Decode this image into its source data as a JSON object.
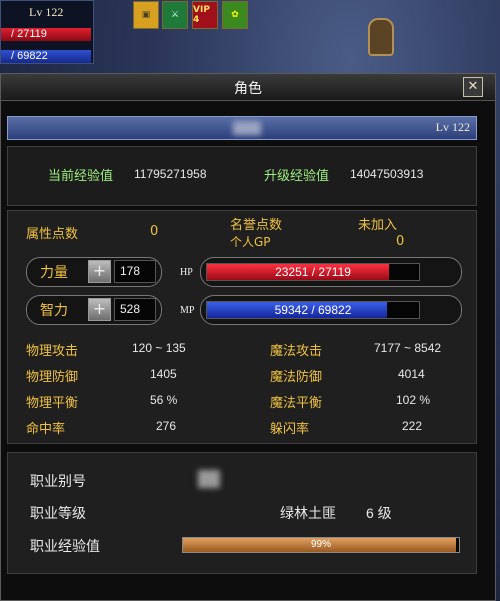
{
  "hud": {
    "level": "Lv 122",
    "hp_text": "/ 27119",
    "mp_text": "/ 69822",
    "hp_color": "#e02030",
    "mp_color": "#3050d0",
    "buffs": [
      {
        "icon": "treasure-chest-icon",
        "label": ""
      },
      {
        "icon": "sword-icon",
        "label": ""
      },
      {
        "icon": "vip-icon",
        "label": "VIP 4"
      },
      {
        "icon": "herb-icon",
        "label": ""
      }
    ]
  },
  "window": {
    "title": "角色",
    "close_label": "✕",
    "level": "Lv 122",
    "exp": {
      "current_label": "当前经验值",
      "current_value": "11795271958",
      "next_label": "升级经验值",
      "next_value": "14047503913"
    },
    "stats": {
      "attr_points_label": "属性点数",
      "attr_points_value": "0",
      "honor_label": "名誉点数",
      "honor_value": "未加入",
      "gp_label": "个人GP",
      "gp_value": "0",
      "strength_label": "力量",
      "strength_value": "178",
      "hp_tag": "HP",
      "hp_text": "23251 / 27119",
      "hp_current": 23251,
      "hp_max": 27119,
      "intellect_label": "智力",
      "intellect_value": "528",
      "mp_tag": "MP",
      "mp_text": "59342 / 69822",
      "mp_current": 59342,
      "mp_max": 69822,
      "plus_symbol": "+",
      "rows": [
        {
          "label_left": "物理攻击",
          "value_left": "120 ~ 135",
          "label_right": "魔法攻击",
          "value_right": "7177 ~ 8542"
        },
        {
          "label_left": "物理防御",
          "value_left": "1405",
          "label_right": "魔法防御",
          "value_right": "4014"
        },
        {
          "label_left": "物理平衡",
          "value_left": "56 %",
          "label_right": "魔法平衡",
          "value_right": "102 %"
        },
        {
          "label_left": "命中率",
          "value_left": "276",
          "label_right": "躲闪率",
          "value_right": "222"
        }
      ]
    },
    "job": {
      "id_label": "职业别号",
      "level_label": "职业等级",
      "class_name": "绿林土匪",
      "class_level": "6 级",
      "exp_label": "职业经验值",
      "exp_text": "99%",
      "exp_fraction": 0.99
    }
  }
}
